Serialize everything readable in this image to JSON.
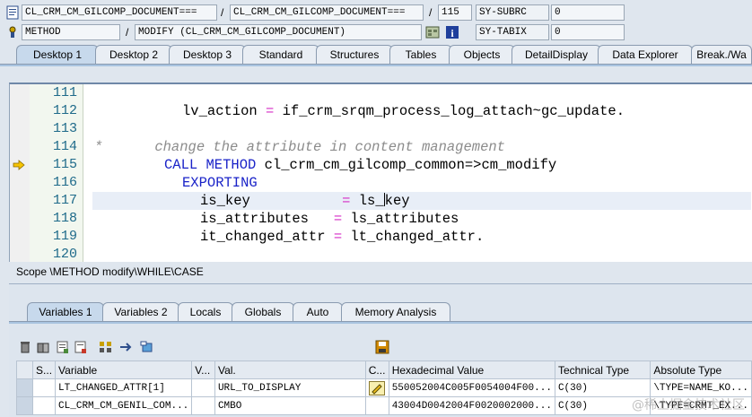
{
  "info_row1": {
    "program": "CL_CRM_CM_GILCOMP_DOCUMENT===",
    "include": "CL_CRM_CM_GILCOMP_DOCUMENT===",
    "line": "115",
    "sysfield_label": "SY-SUBRC",
    "sysfield_value": "0"
  },
  "info_row2": {
    "event_type": "METHOD",
    "event_name": "MODIFY (CL_CRM_CM_GILCOMP_DOCUMENT)",
    "sysfield_label": "SY-TABIX",
    "sysfield_value": "0"
  },
  "desktop_tabs": [
    "Desktop 1",
    "Desktop 2",
    "Desktop 3",
    "Standard",
    "Structures",
    "Tables",
    "Objects",
    "DetailDisplay",
    "Data Explorer",
    "Break./Wa"
  ],
  "editor": {
    "lines": [
      {
        "no": "111"
      },
      {
        "no": "112"
      },
      {
        "no": "113"
      },
      {
        "no": "114"
      },
      {
        "no": "115"
      },
      {
        "no": "116"
      },
      {
        "no": "117"
      },
      {
        "no": "118"
      },
      {
        "no": "119"
      },
      {
        "no": "120"
      }
    ],
    "code": {
      "l112_a": "lv_action ",
      "l112_op": "=",
      "l112_b": " if_crm_srqm_process_log_attach~gc_update.",
      "l114_star": "*",
      "l114_comment": "change the attribute in content management",
      "l115_kw": "CALL METHOD",
      "l115_rest": " cl_crm_cm_gilcomp_common=>cm_modify",
      "l116_kw": "EXPORTING",
      "l117_a": "is_key           ",
      "l117_op": "=",
      "l117_b1": " ls_",
      "l117_b2": "key",
      "l118_a": "is_attributes   ",
      "l118_op": "=",
      "l118_b": " ls_attributes",
      "l119_a": "it_changed_attr ",
      "l119_op": "=",
      "l119_b": " lt_changed_attr."
    }
  },
  "scope": "Scope \\METHOD modify\\WHILE\\CASE",
  "var_tabs": [
    "Variables 1",
    "Variables 2",
    "Locals",
    "Globals",
    "Auto",
    "Memory Analysis"
  ],
  "var_table": {
    "headers": [
      "S...",
      "Variable",
      "V...",
      "Val.",
      "C...",
      "Hexadecimal Value",
      "Technical Type",
      "Absolute Type"
    ],
    "rows": [
      {
        "variable": "LT_CHANGED_ATTR[1]",
        "val": "URL_TO_DISPLAY",
        "hex": "550052004C005F0054004F00...",
        "tech": "C(30)",
        "abs": "\\TYPE=NAME_KO..."
      },
      {
        "variable": "CL_CRM_CM_GENIL_COM...",
        "val": "CMBO",
        "hex": "43004D0042004F0020002000...",
        "tech": "C(30)",
        "abs": "\\TYPE=CRMT_EX..."
      }
    ]
  },
  "watermark": "@稀土掘金技术社区"
}
